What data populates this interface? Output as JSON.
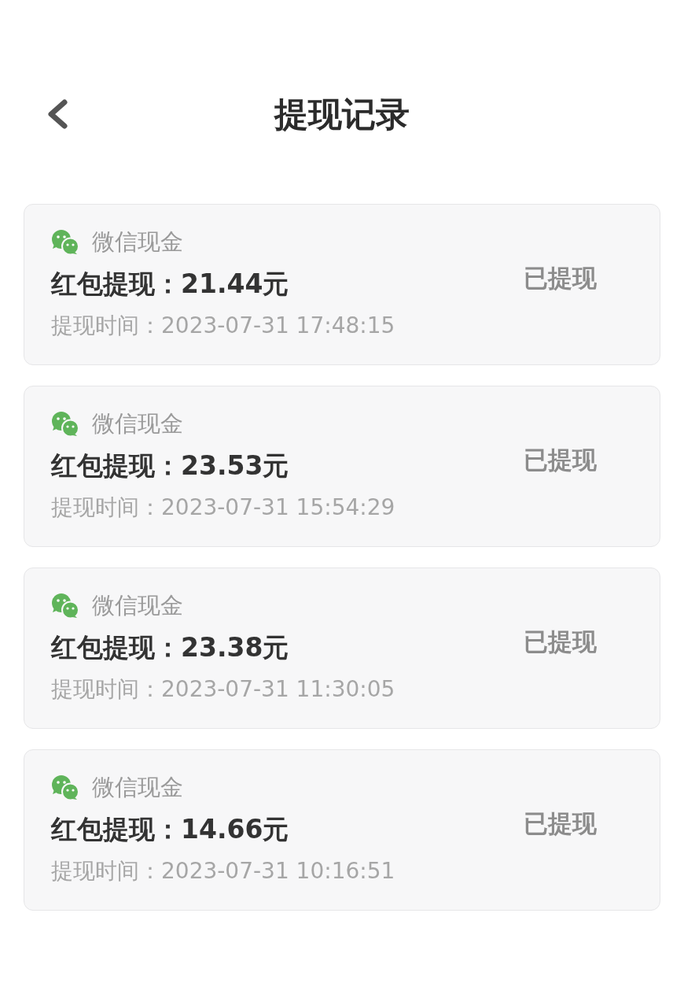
{
  "header": {
    "title": "提现记录"
  },
  "records": [
    {
      "source": "微信现金",
      "title": "红包提现：21.44元",
      "time": "提现时间：2023-07-31 17:48:15",
      "status": "已提现"
    },
    {
      "source": "微信现金",
      "title": "红包提现：23.53元",
      "time": "提现时间：2023-07-31 15:54:29",
      "status": "已提现"
    },
    {
      "source": "微信现金",
      "title": "红包提现：23.38元",
      "time": "提现时间：2023-07-31 11:30:05",
      "status": "已提现"
    },
    {
      "source": "微信现金",
      "title": "红包提现：14.66元",
      "time": "提现时间：2023-07-31 10:16:51",
      "status": "已提现"
    }
  ]
}
